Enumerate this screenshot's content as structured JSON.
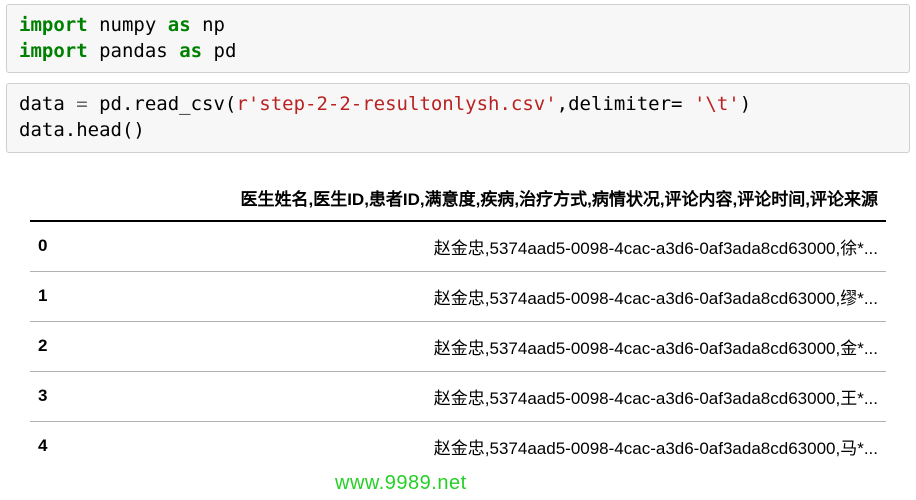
{
  "code_cells": {
    "cell1": {
      "import1_kw": "import",
      "import1_mod": "numpy",
      "import1_as": "as",
      "import1_alias": "np",
      "import2_kw": "import",
      "import2_mod": "pandas",
      "import2_as": "as",
      "import2_alias": "pd"
    },
    "cell2": {
      "line1_left": "data ",
      "line1_eq": "=",
      "line1_mid": " pd.read_csv(",
      "line1_str1": "r'step-2-2-resultonlysh.csv'",
      "line1_mid2": ",delimiter= ",
      "line1_str2": "'\\t'",
      "line1_end": ")",
      "line2": "data.head()"
    }
  },
  "dataframe": {
    "column_header": "医生姓名,医生ID,患者ID,满意度,疾病,治疗方式,病情状况,评论内容,评论时间,评论来源",
    "rows": [
      {
        "idx": "0",
        "val": "赵金忠,5374aad5-0098-4cac-a3d6-0af3ada8cd63000,徐*..."
      },
      {
        "idx": "1",
        "val": "赵金忠,5374aad5-0098-4cac-a3d6-0af3ada8cd63000,缪*..."
      },
      {
        "idx": "2",
        "val": "赵金忠,5374aad5-0098-4cac-a3d6-0af3ada8cd63000,金*..."
      },
      {
        "idx": "3",
        "val": "赵金忠,5374aad5-0098-4cac-a3d6-0af3ada8cd63000,王*..."
      },
      {
        "idx": "4",
        "val": "赵金忠,5374aad5-0098-4cac-a3d6-0af3ada8cd63000,马*..."
      }
    ]
  },
  "watermark": "www.9989.net"
}
